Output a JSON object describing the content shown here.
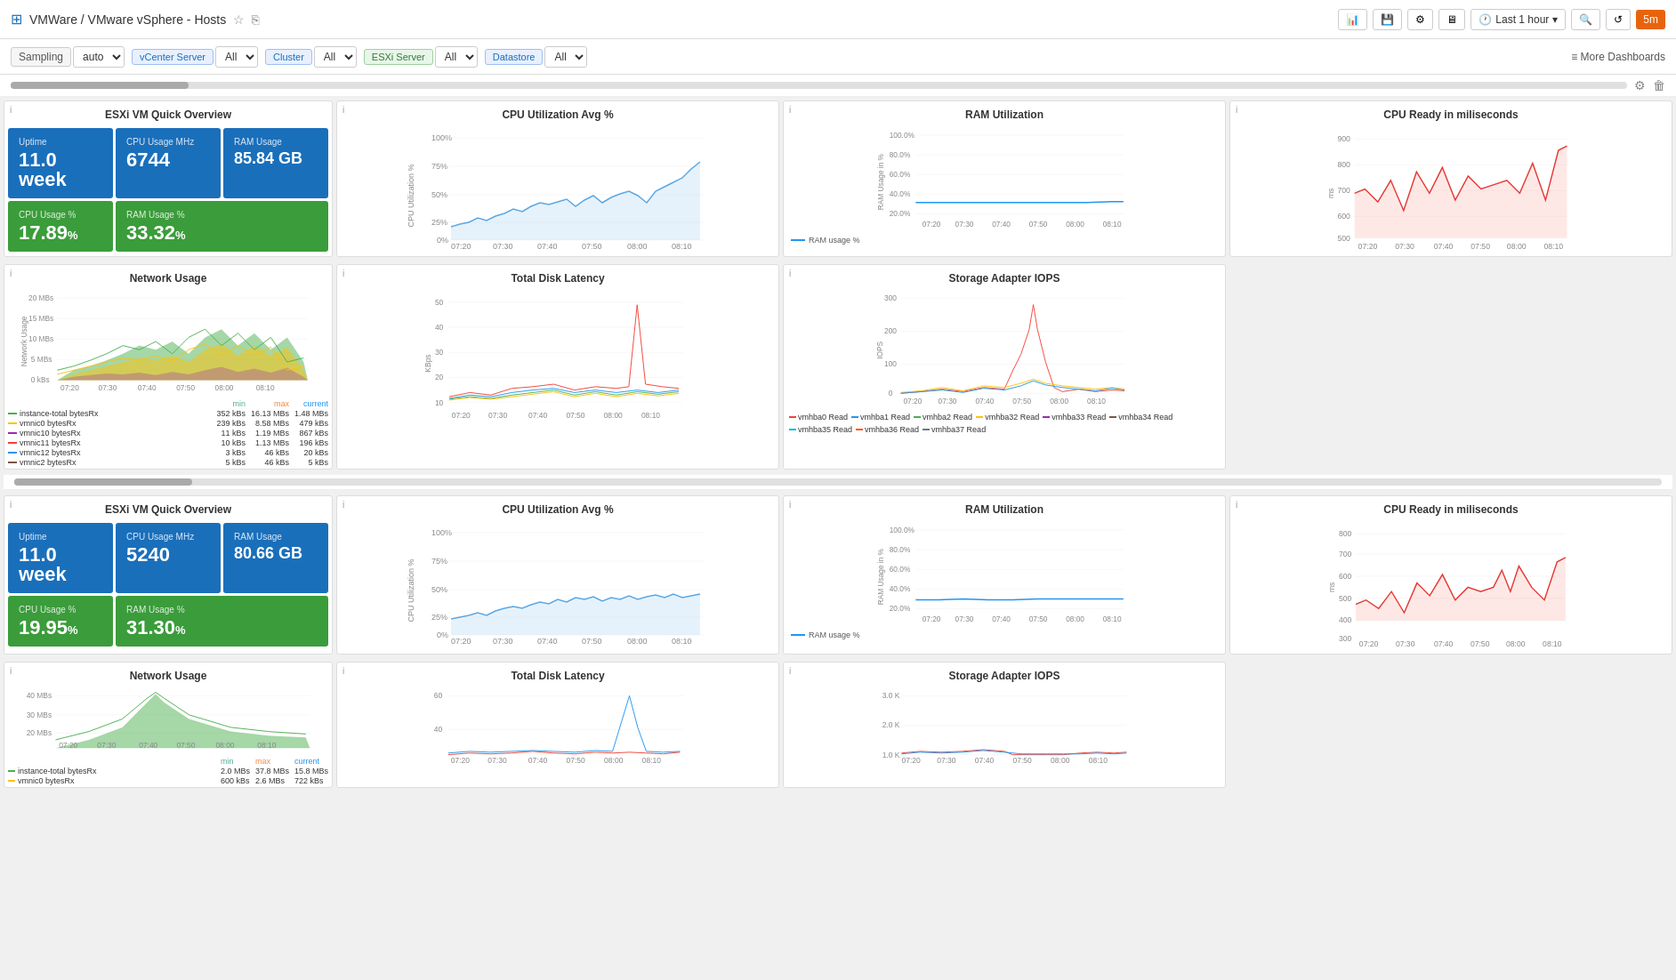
{
  "header": {
    "logo": "⊞",
    "breadcrumb": "VMWare / VMware vSphere - Hosts",
    "star_icon": "★",
    "share_icon": "⎘",
    "add_panel_icon": "📊",
    "save_icon": "💾",
    "settings_icon": "⚙",
    "monitor_icon": "🖥",
    "time_icon": "🕐",
    "time_label": "Last 1 hour",
    "search_icon": "🔍",
    "refresh_icon": "↺",
    "interval_label": "5m"
  },
  "filters": {
    "sampling_label": "Sampling",
    "sampling_value": "auto",
    "vcenter_label": "vCenter Server",
    "vcenter_value": "All",
    "cluster_label": "Cluster",
    "cluster_value": "All",
    "esxi_label": "ESXi Server",
    "esxi_value": "All",
    "datastore_label": "Datastore",
    "datastore_value": "All",
    "more_dashboards": "≡ More Dashboards"
  },
  "panel1": {
    "title": "ESXi VM Quick Overview",
    "uptime_label": "Uptime",
    "uptime_value": "11.0 week",
    "cpu_mhz_label": "CPU Usage MHz",
    "cpu_mhz_value": "6744",
    "ram_usage_label": "RAM Usage",
    "ram_usage_value": "85.84 GB",
    "cpu_pct_label": "CPU Usage %",
    "cpu_pct_value": "17.89",
    "cpu_pct_unit": "%",
    "ram_pct_label": "RAM Usage %",
    "ram_pct_value": "33.32",
    "ram_pct_unit": "%"
  },
  "panel2": {
    "title": "CPU Utilization Avg %",
    "y_max": "100%",
    "y_75": "75%",
    "y_50": "50%",
    "y_25": "25%",
    "y_0": "0%",
    "x_labels": [
      "07:20",
      "07:30",
      "07:40",
      "07:50",
      "08:00",
      "08:10"
    ],
    "y_axis_title": "CPU Utilization %"
  },
  "panel3": {
    "title": "RAM Utilization",
    "y_labels": [
      "100.0%",
      "80.0%",
      "60.0%",
      "40.0%",
      "20.0%"
    ],
    "x_labels": [
      "07:20",
      "07:30",
      "07:40",
      "07:50",
      "08:00",
      "08:10"
    ],
    "y_axis_title": "RAM Usage in %",
    "legend_label": "RAM usage %"
  },
  "panel4": {
    "title": "CPU Ready in miliseconds",
    "y_labels": [
      "900",
      "800",
      "700",
      "600",
      "500"
    ],
    "x_labels": [
      "07:20",
      "07:30",
      "07:40",
      "07:50",
      "08:00",
      "08:10"
    ],
    "y_axis_title": "ms"
  },
  "panel5": {
    "title": "Network Usage",
    "y_labels": [
      "20 MBs",
      "15 MBs",
      "10 MBs",
      "5 MBs",
      "0 kBs"
    ],
    "x_labels": [
      "07:20",
      "07:30",
      "07:40",
      "07:50",
      "08:00",
      "08:10"
    ],
    "legend": [
      {
        "name": "instance-total bytesRx",
        "color": "#4CAF50",
        "min": "352 kBs",
        "max": "16.13 MBs",
        "current": "1.48 MBs"
      },
      {
        "name": "vmnic0 bytesRx",
        "color": "#FFC107",
        "min": "239 kBs",
        "max": "8.58 MBs",
        "current": "479 kBs"
      },
      {
        "name": "vmnic10 bytesRx",
        "color": "#9C27B0",
        "min": "11 kBs",
        "max": "1.19 MBs",
        "current": "867 kBs"
      },
      {
        "name": "vmnic11 bytesRx",
        "color": "#F44336",
        "min": "10 kBs",
        "max": "1.13 MBs",
        "current": "196 kBs"
      },
      {
        "name": "vmnic12 bytesRx",
        "color": "#2196F3",
        "min": "3 kBs",
        "max": "46 kBs",
        "current": "20 kBs"
      },
      {
        "name": "vmnic2 bytesRx",
        "color": "#795548",
        "min": "5 kBs",
        "max": "46 kBs",
        "current": "5 kBs"
      }
    ],
    "col_labels": [
      "min",
      "max",
      "current"
    ]
  },
  "panel6": {
    "title": "Total Disk Latency",
    "y_labels": [
      "50",
      "40",
      "30",
      "20",
      "10"
    ],
    "x_labels": [
      "07:20",
      "07:30",
      "07:40",
      "07:50",
      "08:00",
      "08:10"
    ],
    "y_axis_title": "KBps"
  },
  "panel7": {
    "title": "Storage Adapter IOPS",
    "y_labels": [
      "300",
      "200",
      "100",
      "0"
    ],
    "x_labels": [
      "07:20",
      "07:30",
      "07:40",
      "07:50",
      "08:00",
      "08:10"
    ],
    "y_axis_title": "IOPS",
    "legend": [
      {
        "name": "vmhba0 Read",
        "color": "#F44336"
      },
      {
        "name": "vmhba1 Read",
        "color": "#2196F3"
      },
      {
        "name": "vmhba2 Read",
        "color": "#4CAF50"
      },
      {
        "name": "vmhba32 Read",
        "color": "#FFC107"
      },
      {
        "name": "vmhba33 Read",
        "color": "#9C27B0"
      },
      {
        "name": "vmhba34 Read",
        "color": "#795548"
      },
      {
        "name": "vmhba35 Read",
        "color": "#00BCD4"
      },
      {
        "name": "vmhba36 Read",
        "color": "#FF5722"
      },
      {
        "name": "vmhba37 Read",
        "color": "#607D8B"
      }
    ]
  },
  "panel8": {
    "title": "ESXi VM Quick Overview",
    "uptime_label": "Uptime",
    "uptime_value": "11.0 week",
    "cpu_mhz_label": "CPU Usage MHz",
    "cpu_mhz_value": "5240",
    "ram_usage_label": "RAM Usage",
    "ram_usage_value": "80.66 GB",
    "cpu_pct_label": "CPU Usage %",
    "cpu_pct_value": "19.95",
    "cpu_pct_unit": "%",
    "ram_pct_label": "RAM Usage %",
    "ram_pct_value": "31.30",
    "ram_pct_unit": "%"
  },
  "panel9": {
    "title": "CPU Utilization Avg %",
    "y_max": "100%",
    "y_75": "75%",
    "y_50": "50%",
    "y_25": "25%",
    "y_0": "0%",
    "x_labels": [
      "07:20",
      "07:30",
      "07:40",
      "07:50",
      "08:00",
      "08:10"
    ]
  },
  "panel10": {
    "title": "RAM Utilization",
    "legend_label": "RAM usage %"
  },
  "panel11": {
    "title": "CPU Ready in miliseconds",
    "y_labels": [
      "800",
      "700",
      "600",
      "500",
      "400",
      "300"
    ]
  },
  "panel12": {
    "title": "Network Usage",
    "legend": [
      {
        "name": "instance-total bytesRx",
        "color": "#4CAF50",
        "min": "2.0 MBs",
        "max": "37.8 MBs",
        "current": "15.8 MBs"
      },
      {
        "name": "vmnic0 bytesRx",
        "color": "#FFC107",
        "min": "600 kBs",
        "max": "2.6 MBs",
        "current": "722 kBs"
      }
    ]
  },
  "panel13": {
    "title": "Total Disk Latency",
    "y_labels": [
      "60",
      "40"
    ]
  },
  "panel14": {
    "title": "Storage Adapter IOPS",
    "y_labels": [
      "3.0 K",
      "2.0 K",
      "1.0 K"
    ]
  }
}
